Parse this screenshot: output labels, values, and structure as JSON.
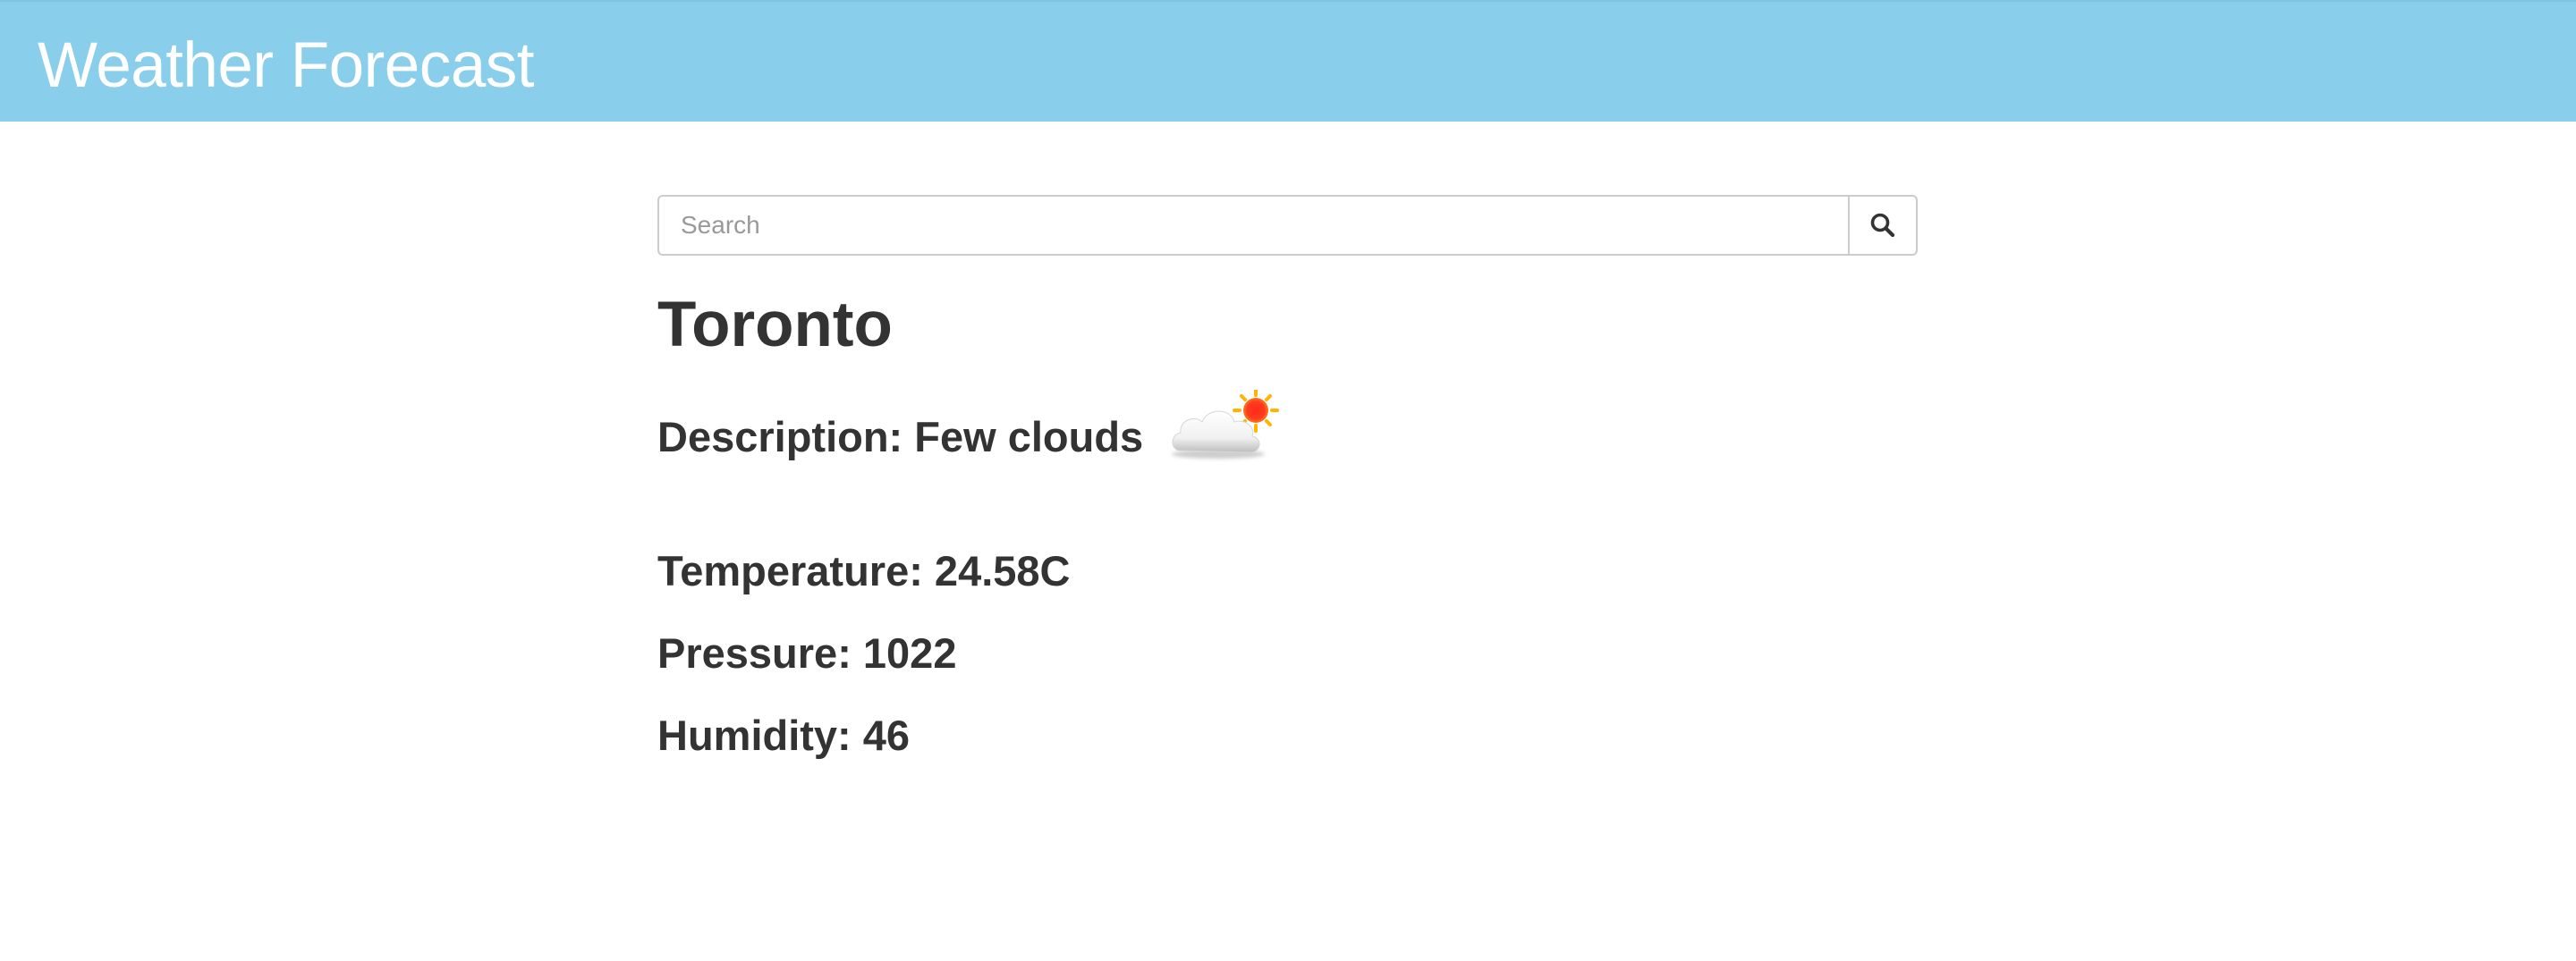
{
  "header": {
    "title": "Weather Forecast",
    "background_color": "#89ceea"
  },
  "search": {
    "placeholder": "Search",
    "value": "",
    "button_icon": "search-icon"
  },
  "weather": {
    "city": "Toronto",
    "description_label": "Description:",
    "description_value": "Few clouds",
    "description_text": "Description: Few clouds",
    "icon": "few-clouds-icon",
    "temperature_text": "Temperature: 24.58C",
    "pressure_text": "Pressure: 1022",
    "humidity_text": "Humidity: 46"
  }
}
